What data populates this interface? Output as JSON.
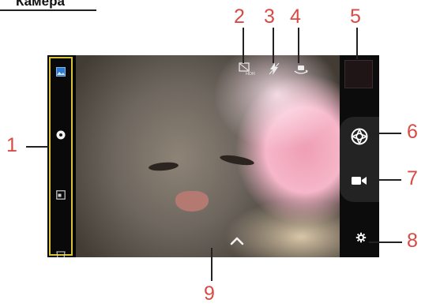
{
  "header": {
    "title": "Камера"
  },
  "camera": {
    "sidebar": {
      "items": [
        "gallery-icon",
        "record-dot-icon",
        "mode-frame-icon",
        "panorama-icon"
      ]
    },
    "top_controls": [
      "hdr-icon",
      "flash-icon",
      "switch-camera-icon"
    ],
    "top_labels": {
      "hdr": "HDR"
    },
    "right_controls": [
      "thumbnail",
      "shutter-icon",
      "video-camera-icon",
      "gear-icon"
    ],
    "bottom_controls": [
      "chevron-up-icon"
    ]
  },
  "callouts": [
    "1",
    "2",
    "3",
    "4",
    "5",
    "6",
    "7",
    "8",
    "9"
  ],
  "colors": {
    "accent": "#d9c437",
    "callout": "#d94a44",
    "panel": "#0c0c0c"
  }
}
